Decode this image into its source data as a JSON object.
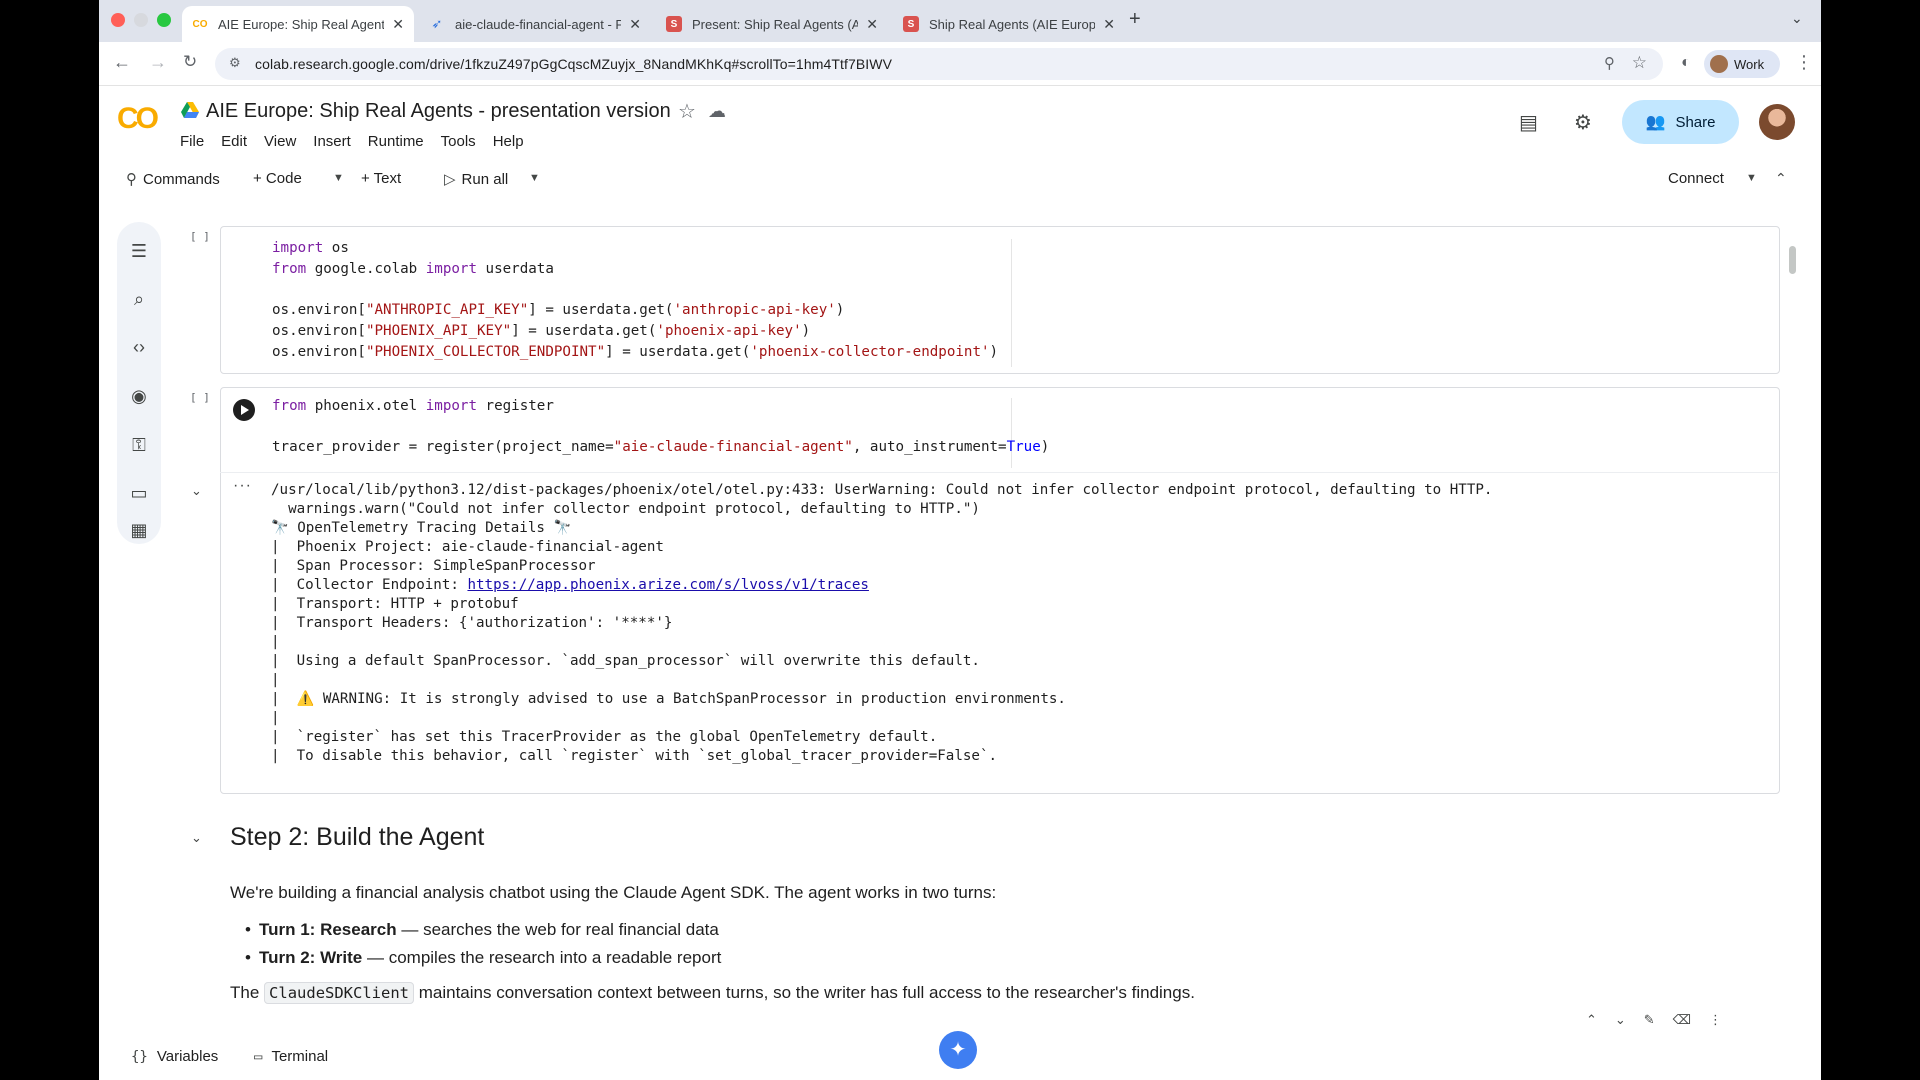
{
  "browser": {
    "tabs": [
      {
        "title": "AIE Europe: Ship Real Agents",
        "favicon": "colab-icon",
        "active": true
      },
      {
        "title": "aie-claude-financial-agent - P",
        "favicon": "arize-icon",
        "active": false
      },
      {
        "title": "Present: Ship Real Agents (Al",
        "favicon": "slides-icon",
        "active": false
      },
      {
        "title": "Ship Real Agents (AIE Europe",
        "favicon": "slides-icon",
        "active": false
      }
    ],
    "url": "colab.research.google.com/drive/1fkzuZ497pGgCqscMZuyjx_8NandMKhKq#scrollTo=1hm4Ttf7BIWV",
    "profile_label": "Work"
  },
  "colab": {
    "logo_text": "CO",
    "doc_title": "AIE Europe: Ship Real Agents - presentation version",
    "menu": [
      "File",
      "Edit",
      "View",
      "Insert",
      "Runtime",
      "Tools",
      "Help"
    ],
    "share_label": "Share",
    "toolbar": {
      "commands": "Commands",
      "code": "+ Code",
      "text": "+ Text",
      "run_all": "Run all",
      "connect": "Connect"
    }
  },
  "cells": {
    "cell1_count": "[ ]",
    "cell2_count": "[ ]",
    "output_lines": [
      "/usr/local/lib/python3.12/dist-packages/phoenix/otel/otel.py:433: UserWarning: Could not infer collector endpoint protocol, defaulting to HTTP.",
      "  warnings.warn(\"Could not infer collector endpoint protocol, defaulting to HTTP.\")",
      "🔭 OpenTelemetry Tracing Details 🔭",
      "|  Phoenix Project: aie-claude-financial-agent",
      "|  Span Processor: SimpleSpanProcessor",
      "|  Collector Endpoint: ",
      "|  Transport: HTTP + protobuf",
      "|  Transport Headers: {'authorization': '****'}",
      "|",
      "|  Using a default SpanProcessor. `add_span_processor` will overwrite this default.",
      "|",
      "|  ⚠️ WARNING: It is strongly advised to use a BatchSpanProcessor in production environments.",
      "|",
      "|  `register` has set this TracerProvider as the global OpenTelemetry default.",
      "|  To disable this behavior, call `register` with `set_global_tracer_provider=False`."
    ],
    "collector_url": "https://app.phoenix.arize.com/s/lvoss/v1/traces"
  },
  "markdown": {
    "heading": "Step 2: Build the Agent",
    "intro": "We're building a financial analysis chatbot using the Claude Agent SDK. The agent works in two turns:",
    "bullet1_bold": "Turn 1: Research",
    "bullet1_rest": " — searches the web for real financial data",
    "bullet2_bold": "Turn 2: Write",
    "bullet2_rest": " — compiles the research into a readable report",
    "closing_pre": "The ",
    "closing_code": "ClaudeSDKClient",
    "closing_post": " maintains conversation context between turns, so the writer has full access to the researcher's findings."
  },
  "bottom": {
    "variables": "Variables",
    "terminal": "Terminal"
  },
  "colors": {
    "accent": "#c2e7ff",
    "keyword": "#7b1fa2",
    "string": "#a31515",
    "link": "#1a0dab"
  }
}
